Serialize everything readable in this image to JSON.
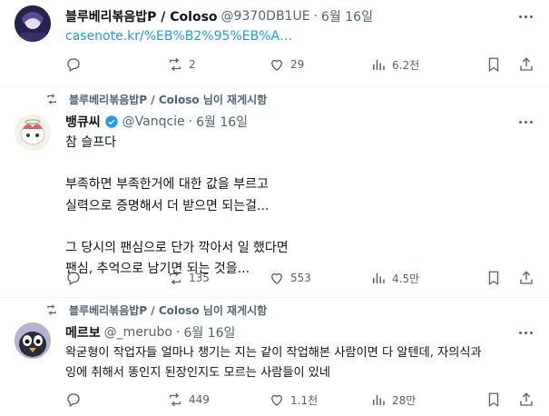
{
  "tweets": [
    {
      "author": "블루베리볶음밥P / Coloso",
      "handle": "@9370DB1UE",
      "date": "6월 16일",
      "link": "casenote.kr/%EB%B2%95%EB%A…",
      "stats": {
        "replies": "",
        "retweets": "2",
        "likes": "29",
        "views": "6.2천"
      }
    },
    {
      "retweeted_by": "블루베리볶음밥P / Coloso 님이 재게시함",
      "author": "뱅큐씨",
      "handle": "@Vanqcie",
      "date": "6월 16일",
      "text": "참 슬프다\n\n부족하면 부족한거에 대한 값을 부르고\n실력으로 증명해서 더 받으면 되는걸...\n\n그 당시의 팬심으로 단가 깍아서 일 했다면\n팬심, 추억으로 남기면 되는 것을...",
      "stats": {
        "replies": "",
        "retweets": "135",
        "likes": "553",
        "views": "4.5만"
      }
    },
    {
      "retweeted_by": "블루베리볶음밥P / Coloso 님이 재게시함",
      "author": "메르보",
      "handle": "@_merubo",
      "date": "6월 16일",
      "text": "왁굳형이 작업자들 얼마나 챙기는 지는 같이 작업해본 사람이면 다 알텐데, 자의식과\n잉에 취해서 똥인지 된장인지도 모르는 사람들이 있네",
      "stats": {
        "replies": "",
        "retweets": "449",
        "likes": "1.1천",
        "views": "28만"
      }
    }
  ],
  "colors": {
    "accent": "#1d9bf0",
    "muted": "#536471",
    "text": "#0f1419",
    "border": "#eff3f4"
  }
}
